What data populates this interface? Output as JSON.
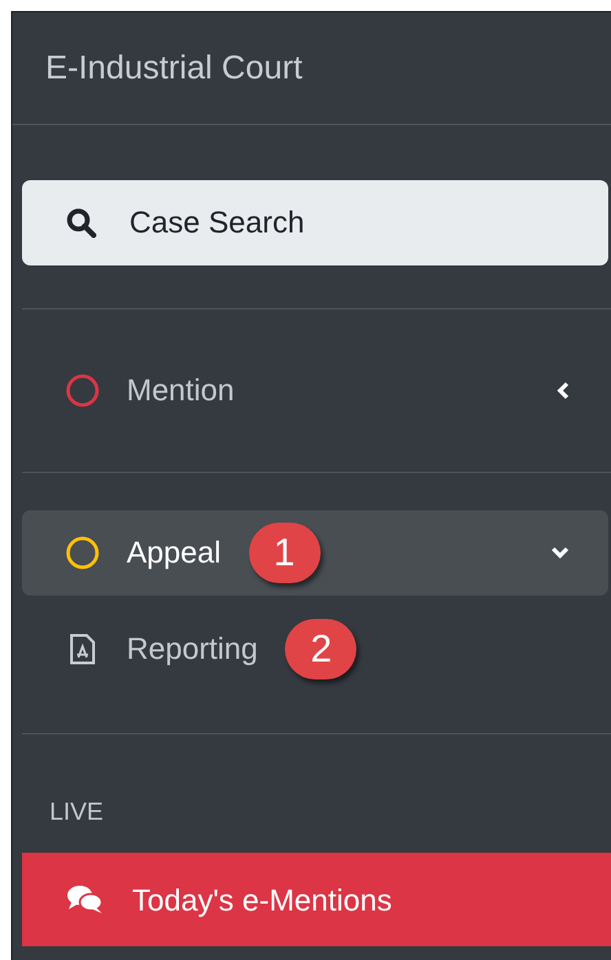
{
  "title": "E-Industrial Court",
  "search_button": {
    "label": "Case Search"
  },
  "sections": [
    {
      "items": [
        {
          "kind": "circle",
          "label": "Mention",
          "color": "#dc3545",
          "expanded": false,
          "selected": false
        }
      ]
    },
    {
      "items": [
        {
          "kind": "circle",
          "label": "Appeal",
          "color": "#ffc107",
          "expanded": true,
          "selected": true,
          "callout": "1"
        },
        {
          "kind": "pdf",
          "label": "Reporting",
          "selected": false,
          "callout": "2"
        }
      ]
    }
  ],
  "live": {
    "heading": "LIVE",
    "item": {
      "label": "Today's e-Mentions"
    }
  }
}
